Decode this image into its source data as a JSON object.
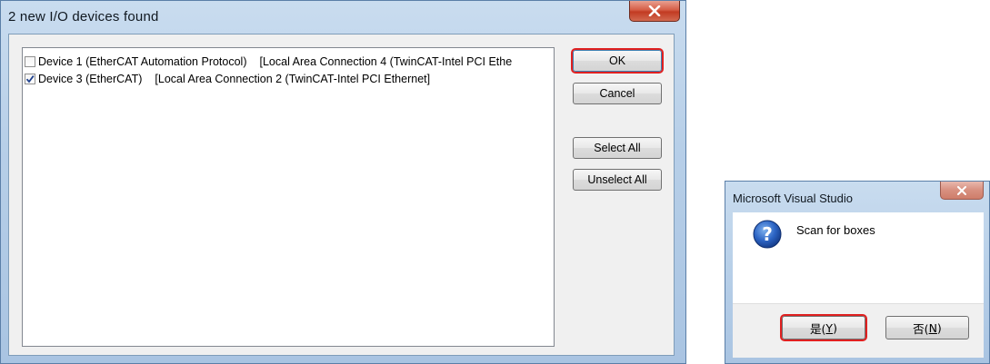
{
  "dialog_devices": {
    "title": "2 new I/O devices found",
    "devices": [
      {
        "checked": false,
        "name": "Device 1 (EtherCAT Automation Protocol)",
        "connection": "[Local Area Connection 4 (TwinCAT-Intel PCI Ethe"
      },
      {
        "checked": true,
        "name": "Device 3 (EtherCAT)",
        "connection": "[Local Area Connection 2 (TwinCAT-Intel PCI Ethernet]"
      }
    ],
    "buttons": {
      "ok": "OK",
      "cancel": "Cancel",
      "select_all": "Select All",
      "unselect_all": "Unselect All"
    }
  },
  "dialog_vs": {
    "title": "Microsoft Visual Studio",
    "message": "Scan for boxes",
    "icon": "question-icon",
    "buttons": {
      "yes_text": "是(",
      "yes_key": "Y",
      "yes_close": ")",
      "no_text": "否(",
      "no_key": "N",
      "no_close": ")"
    }
  },
  "colors": {
    "highlight_outline": "#e02020",
    "title_bar": "#b7cfe8",
    "close_button": "#c23a22"
  }
}
